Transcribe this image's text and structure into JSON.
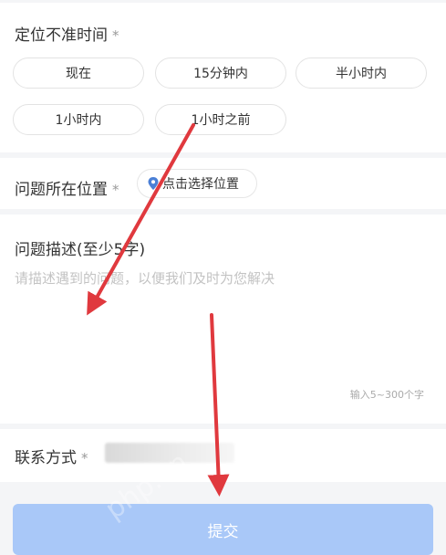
{
  "time_section": {
    "label": "定位不准时间",
    "required_mark": "*",
    "options": [
      "现在",
      "15分钟内",
      "半小时内",
      "1小时内",
      "1小时之前"
    ]
  },
  "location_section": {
    "label": "问题所在位置",
    "required_mark": "*",
    "pin_icon": "location-pin-icon",
    "select_label": "点击选择位置"
  },
  "description_section": {
    "label": "问题描述(至少5字)",
    "placeholder": "请描述遇到的问题，以便我们及时为您解决",
    "counter": "输入5~300个字"
  },
  "contact_section": {
    "label": "联系方式",
    "required_mark": "*"
  },
  "submit": {
    "label": "提交"
  },
  "watermark": "php.cn",
  "colors": {
    "submit_bg": "#a9c8f8",
    "pin": "#4a7fd6",
    "arrow": "#e0393e",
    "gap": "#f4f5f7"
  }
}
